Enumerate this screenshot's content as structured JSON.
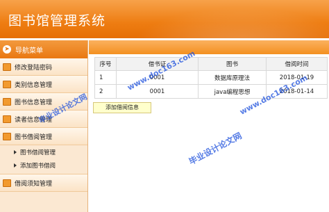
{
  "app": {
    "title": "图书馆管理系统"
  },
  "sidebar": {
    "header": "导航菜单",
    "items": [
      {
        "label": "修改登陆密码"
      },
      {
        "label": "类别信息管理"
      },
      {
        "label": "图书信息管理"
      },
      {
        "label": "读者信息管理"
      },
      {
        "label": "图书借阅管理"
      }
    ],
    "subitems": [
      {
        "label": "图书借阅管理"
      },
      {
        "label": "添加图书借阅"
      }
    ],
    "last_item": {
      "label": "借阅须知管理"
    }
  },
  "table": {
    "headers": [
      "序号",
      "借书证",
      "图书",
      "借阅时间"
    ],
    "rows": [
      [
        "1",
        "0001",
        "数据库原理法",
        "2018-01-19"
      ],
      [
        "2",
        "0001",
        "java编程思想",
        "2018-01-14"
      ]
    ]
  },
  "actions": {
    "add_label": "添加借阅信息"
  },
  "watermarks": {
    "site": "www.doc163.com",
    "text": "毕业设计论文网"
  }
}
